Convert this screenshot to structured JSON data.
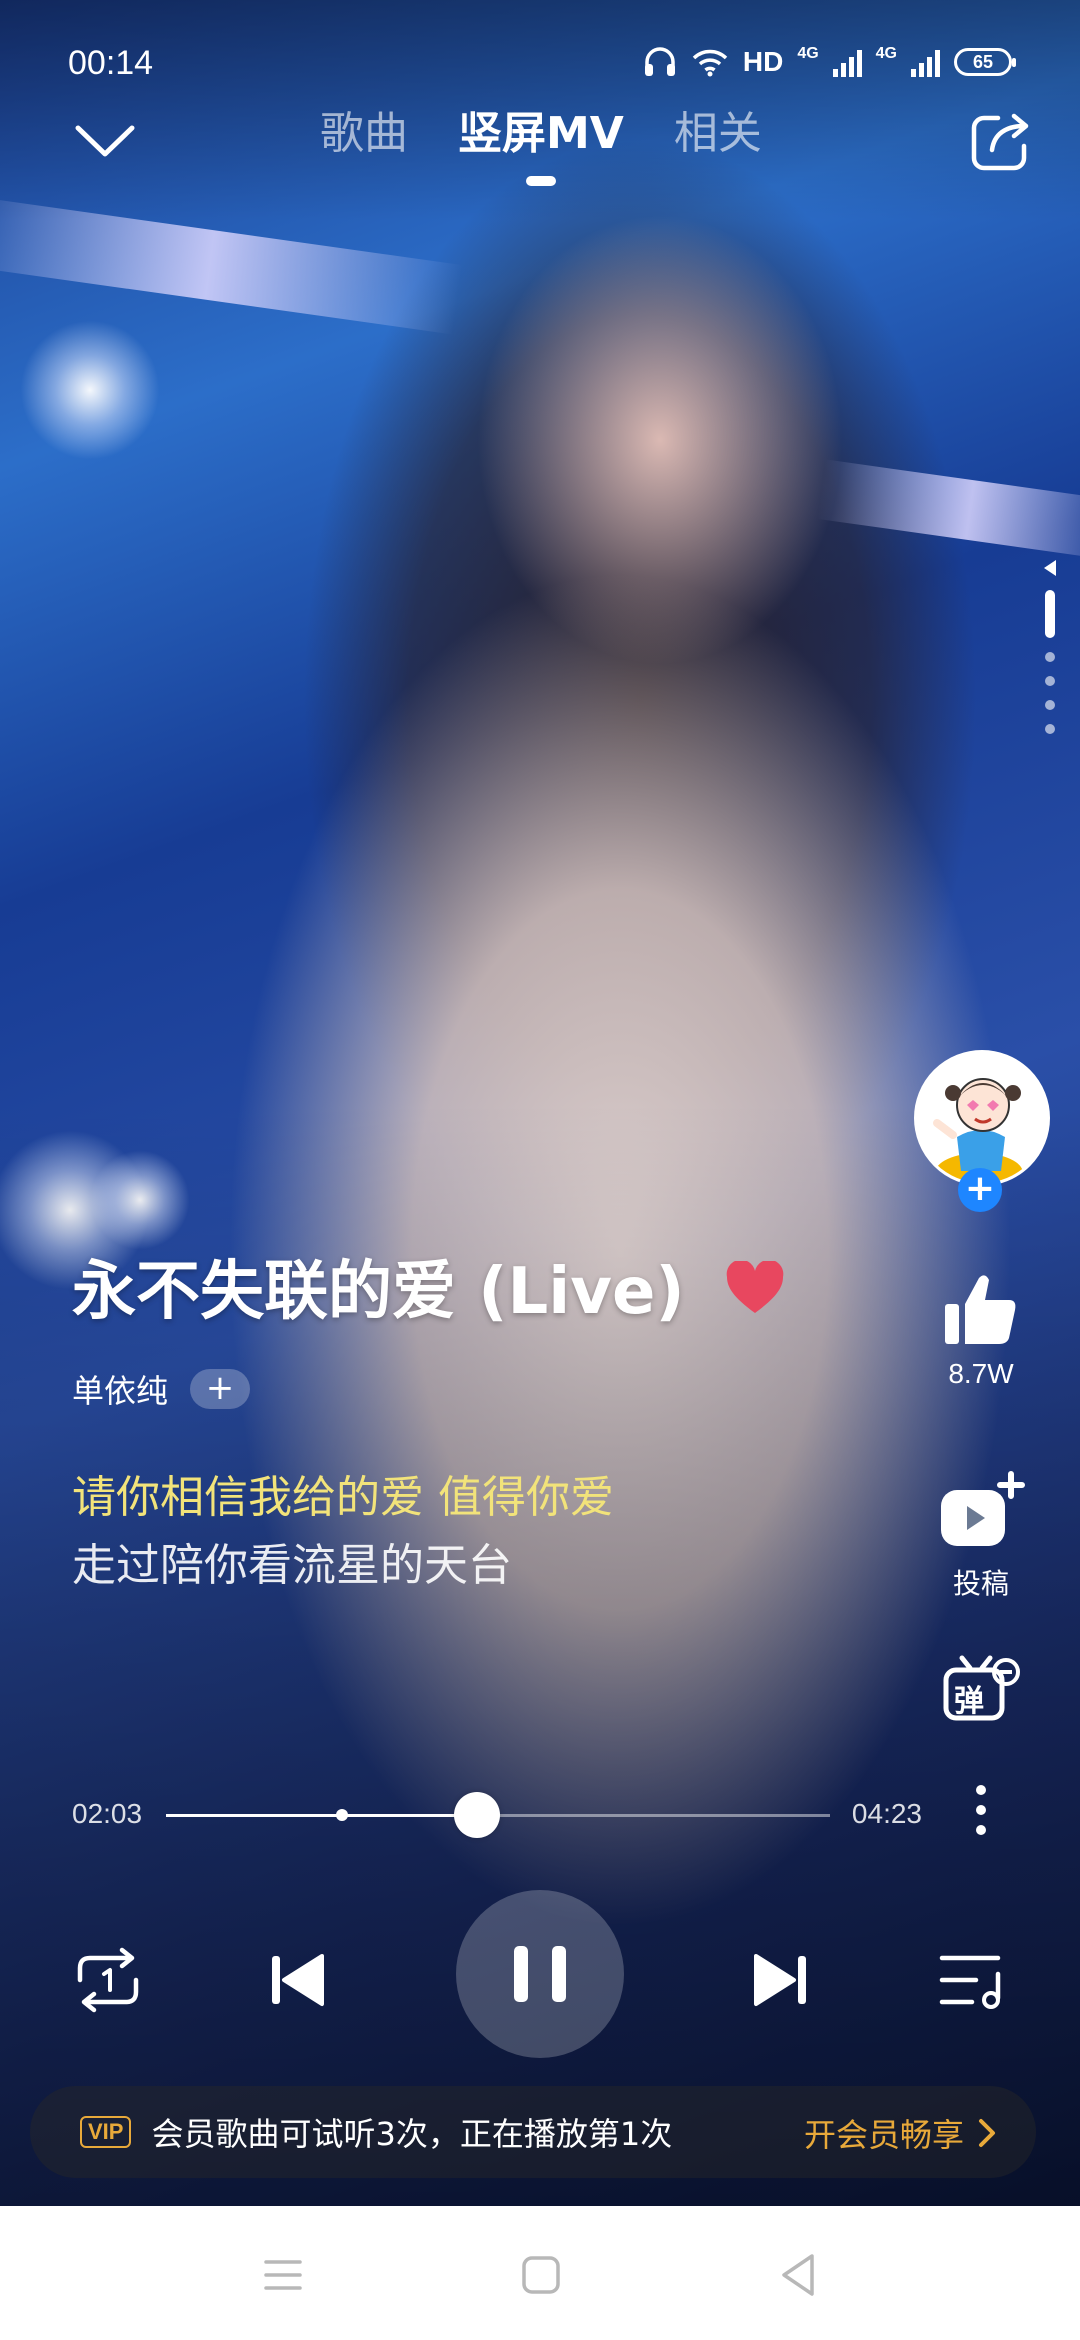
{
  "status_bar": {
    "time": "00:14",
    "network_label": "HD",
    "sim1_label": "4G",
    "sim2_label": "4G",
    "battery": "65"
  },
  "top_nav": {
    "tabs": [
      {
        "label": "歌曲",
        "active": false
      },
      {
        "label": "竖屏MV",
        "active": true
      },
      {
        "label": "相关",
        "active": false
      }
    ]
  },
  "song": {
    "title": "永不失联的爱 (Live)",
    "artist": "单依纯",
    "follow_label": "+",
    "liked": true
  },
  "lyrics": {
    "current": "请你相信我给的爱 值得你爱",
    "next": "走过陪你看流星的天台"
  },
  "actions": {
    "avatar_follow_label": "+",
    "like_count": "8.7W",
    "post_label": "投稿",
    "danmaku_label": "弹"
  },
  "playback": {
    "elapsed": "02:03",
    "duration": "04:23",
    "progress_fraction": 0.468,
    "buffer_fraction": 0.265,
    "state": "playing"
  },
  "vip": {
    "badge": "VIP",
    "message": "会员歌曲可试听3次，正在播放第1次",
    "cta": "开会员畅享"
  },
  "icons": {
    "collapse": "chevron-down-icon",
    "share": "share-icon",
    "heart": "heart-icon",
    "like": "thumbs-up-icon",
    "post": "video-upload-icon",
    "danmaku": "danmaku-icon",
    "more": "more-vertical-icon",
    "repeat": "repeat-one-icon",
    "prev": "skip-previous-icon",
    "pause": "pause-icon",
    "next": "skip-next-icon",
    "playlist": "playlist-icon"
  },
  "colors": {
    "lyric_highlight": "#f2e37a",
    "vip_gold": "#e8a93a",
    "heart_red": "#e8475f",
    "follow_blue": "#1e86ff"
  }
}
